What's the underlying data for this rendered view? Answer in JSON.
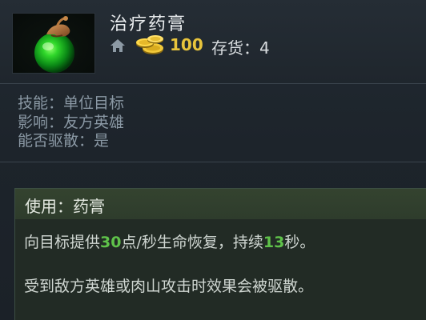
{
  "item": {
    "name": "治疗药膏",
    "icon": "healing-salve-potion-icon",
    "cost": "100",
    "stock_label": "存货：",
    "stock_value": "4"
  },
  "attributes": [
    {
      "label": "技能：",
      "value": "单位目标"
    },
    {
      "label": "影响：",
      "value": "友方英雄"
    },
    {
      "label": "能否驱散：",
      "value": "是"
    }
  ],
  "ability": {
    "title": "使用：药膏",
    "desc1": {
      "pre": "向目标提供",
      "n1": "30",
      "mid": "点/秒生命恢复，持续",
      "n2": "13",
      "post": "秒。"
    },
    "desc2": "受到敌方英雄或肉山攻击时效果会被驱散。"
  },
  "colors": {
    "gold": "#e8c43c",
    "highlight_green": "#5fc24a",
    "attr_text": "#8a98a4",
    "ability_header_bg": "#34432f"
  }
}
